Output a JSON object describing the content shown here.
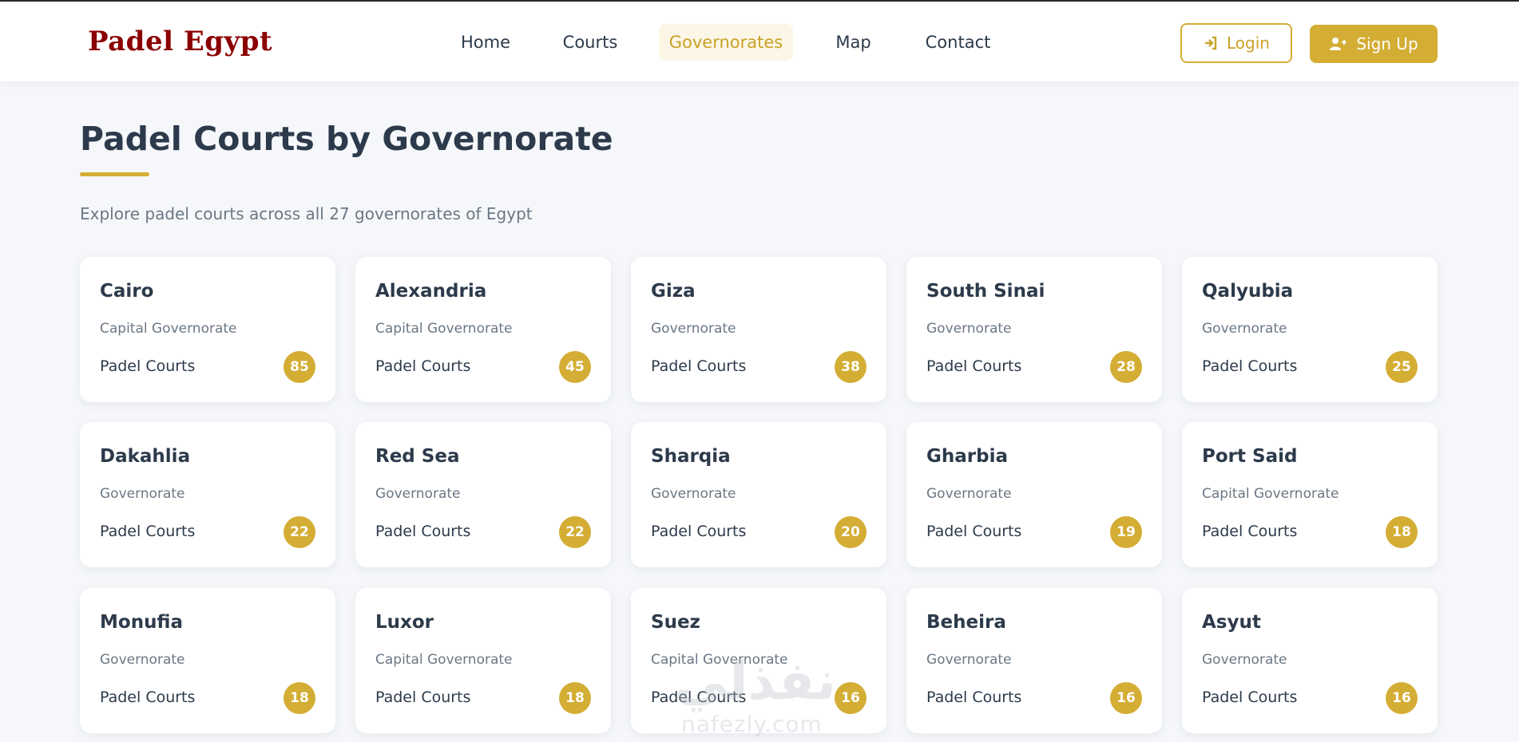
{
  "header": {
    "brand": "Padel Egypt",
    "nav": [
      {
        "label": "Home",
        "active": false
      },
      {
        "label": "Courts",
        "active": false
      },
      {
        "label": "Governorates",
        "active": true
      },
      {
        "label": "Map",
        "active": false
      },
      {
        "label": "Contact",
        "active": false
      }
    ],
    "login_label": "Login",
    "signup_label": "Sign Up",
    "login_icon": "sign-in-icon",
    "signup_icon": "user-plus-icon"
  },
  "page": {
    "title": "Padel Courts by Governorate",
    "subtitle": "Explore padel courts across all 27 governorates of Egypt"
  },
  "cards": [
    {
      "name": "Cairo",
      "type": "Capital Governorate",
      "label": "Padel Courts",
      "count": "85"
    },
    {
      "name": "Alexandria",
      "type": "Capital Governorate",
      "label": "Padel Courts",
      "count": "45"
    },
    {
      "name": "Giza",
      "type": "Governorate",
      "label": "Padel Courts",
      "count": "38"
    },
    {
      "name": "South Sinai",
      "type": "Governorate",
      "label": "Padel Courts",
      "count": "28"
    },
    {
      "name": "Qalyubia",
      "type": "Governorate",
      "label": "Padel Courts",
      "count": "25"
    },
    {
      "name": "Dakahlia",
      "type": "Governorate",
      "label": "Padel Courts",
      "count": "22"
    },
    {
      "name": "Red Sea",
      "type": "Governorate",
      "label": "Padel Courts",
      "count": "22"
    },
    {
      "name": "Sharqia",
      "type": "Governorate",
      "label": "Padel Courts",
      "count": "20"
    },
    {
      "name": "Gharbia",
      "type": "Governorate",
      "label": "Padel Courts",
      "count": "19"
    },
    {
      "name": "Port Said",
      "type": "Capital Governorate",
      "label": "Padel Courts",
      "count": "18"
    },
    {
      "name": "Monufia",
      "type": "Governorate",
      "label": "Padel Courts",
      "count": "18"
    },
    {
      "name": "Luxor",
      "type": "Capital Governorate",
      "label": "Padel Courts",
      "count": "18"
    },
    {
      "name": "Suez",
      "type": "Capital Governorate",
      "label": "Padel Courts",
      "count": "16"
    },
    {
      "name": "Beheira",
      "type": "Governorate",
      "label": "Padel Courts",
      "count": "16"
    },
    {
      "name": "Asyut",
      "type": "Governorate",
      "label": "Padel Courts",
      "count": "16"
    }
  ],
  "watermark": {
    "arabic": "نفذلي",
    "latin": "nafezly.com"
  },
  "colors": {
    "brand": "#8b0000",
    "accent": "#d4ad34",
    "text": "#2c3a4b",
    "muted": "#6b7784",
    "background": "#f5f7fa"
  }
}
